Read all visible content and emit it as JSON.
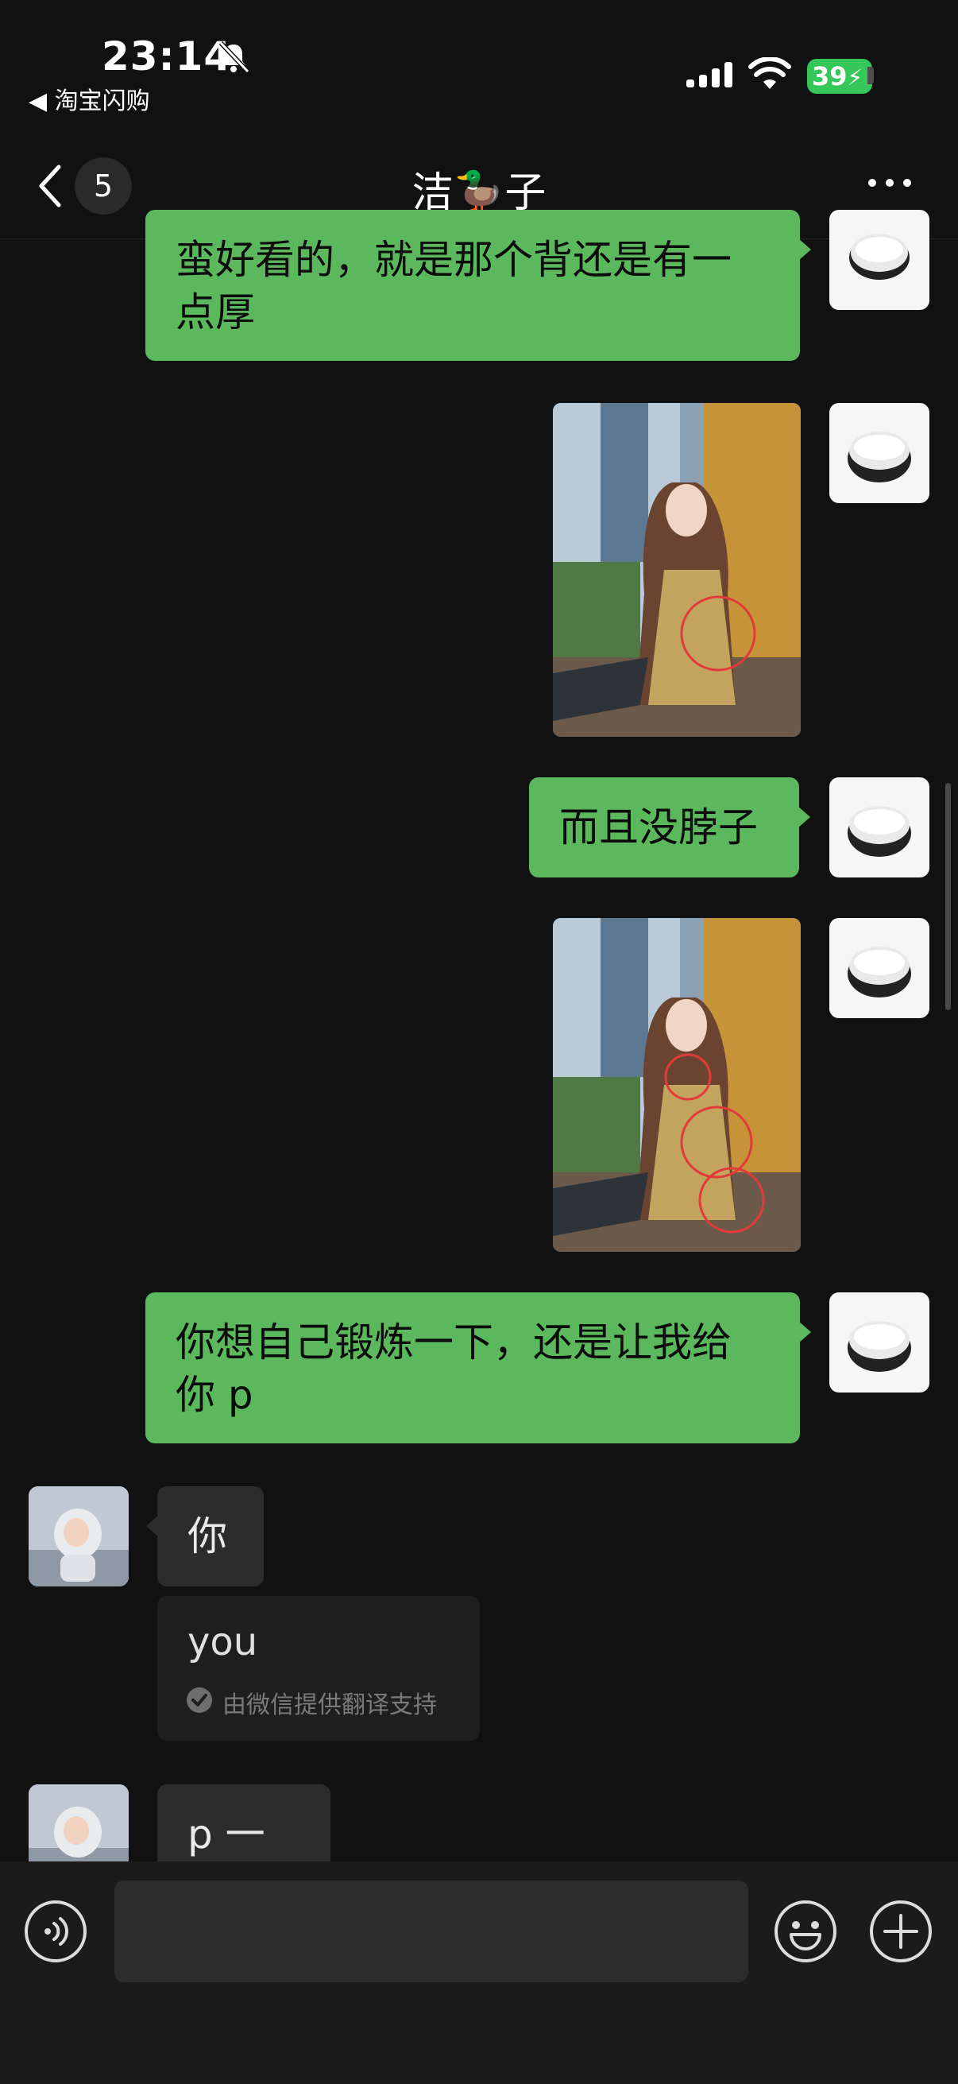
{
  "status_bar": {
    "time": "23:14",
    "back_app": "◀ 淘宝闪购",
    "battery": "39",
    "icons": [
      "bell-slash-icon",
      "signal-icon",
      "wifi-icon",
      "battery-charging-icon"
    ]
  },
  "nav": {
    "unread_count": "5",
    "title": "洁🦆子",
    "icons": [
      "chevron-left-icon",
      "more-icon"
    ]
  },
  "messages": [
    {
      "side": "out",
      "type": "text",
      "lines": [
        "蛮好看的，就是那个背还是有一",
        "点厚"
      ]
    },
    {
      "side": "out",
      "type": "image",
      "image": "photo-woman-cafe-circled"
    },
    {
      "side": "out",
      "type": "text",
      "lines": [
        "而且没脖子"
      ]
    },
    {
      "side": "out",
      "type": "image",
      "image": "photo-woman-cafe-circled-more"
    },
    {
      "side": "out",
      "type": "text",
      "lines": [
        "你想自己锻炼一下，还是让我给",
        "你 p"
      ]
    },
    {
      "side": "in",
      "type": "text",
      "lines": [
        "你"
      ]
    },
    {
      "side": "in",
      "type": "translation",
      "text": "you",
      "provider": "由微信提供翻译支持"
    },
    {
      "side": "in",
      "type": "text",
      "lines": [
        "p 一下"
      ]
    }
  ],
  "input_bar": {
    "icons": [
      "voice-icon",
      "emoji-icon",
      "plus-icon"
    ]
  },
  "colors": {
    "background": "#111111",
    "outgoing_bubble": "#5bb85d",
    "incoming_bubble": "#2c2c2c",
    "battery_green": "#35c759"
  }
}
